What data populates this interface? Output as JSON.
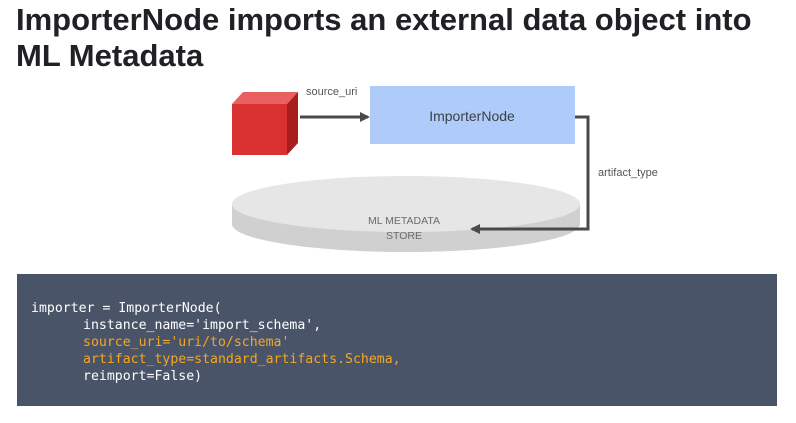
{
  "title": {
    "bold": "ImporterNode",
    "rest": " imports an external data object into",
    "line2": "ML Metadata"
  },
  "diagram": {
    "source_label": "source_uri",
    "node_label": "ImporterNode",
    "artifact_label": "artifact_type",
    "store_line1": "ML METADATA",
    "store_line2": "STORE",
    "colors": {
      "cube_front": "#d93030",
      "cube_top": "#e86060",
      "cube_side": "#a81e1e",
      "node_fill": "#aecbfa",
      "arrow": "#4a4a4a",
      "store_top": "#e6e6e6",
      "store_side": "#d0d0d0"
    }
  },
  "code": {
    "lines": [
      {
        "text": "importer = ImporterNode(",
        "highlight": false,
        "indent": false
      },
      {
        "text": "instance_name='import_schema',",
        "highlight": false,
        "indent": true
      },
      {
        "text": "source_uri='uri/to/schema'",
        "highlight": true,
        "indent": true
      },
      {
        "text": "artifact_type=standard_artifacts.Schema,",
        "highlight": true,
        "indent": true
      },
      {
        "text": "reimport=False)",
        "highlight": false,
        "indent": true
      }
    ],
    "colors": {
      "background": "#4a5469",
      "text": "#ffffff",
      "highlight": "#f5a623"
    }
  }
}
